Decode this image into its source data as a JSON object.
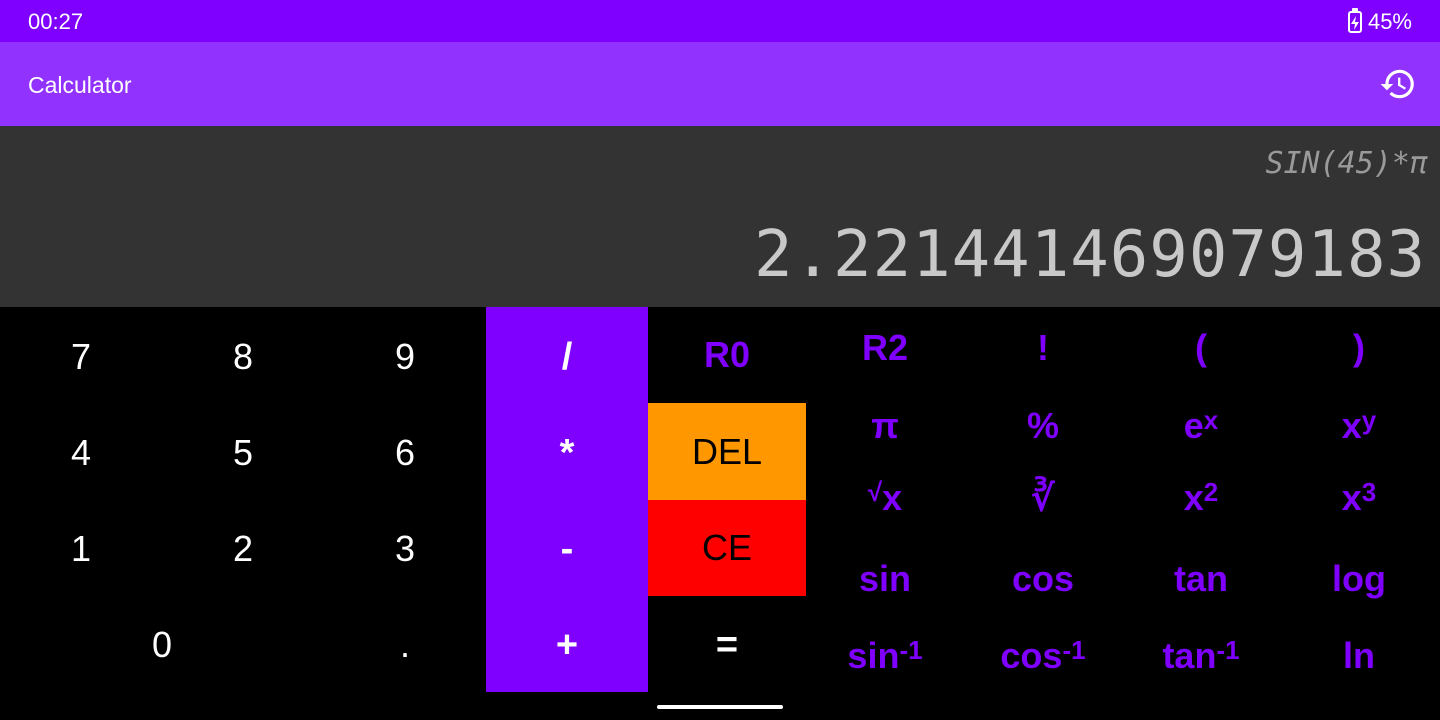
{
  "status_bar": {
    "time": "00:27",
    "battery": "45%"
  },
  "app_bar": {
    "title": "Calculator",
    "history_icon": "history-icon"
  },
  "display": {
    "expression": "SIN(45)*π",
    "result": "2.221441469079183"
  },
  "keypad": {
    "digits": {
      "d7": "7",
      "d8": "8",
      "d9": "9",
      "d4": "4",
      "d5": "5",
      "d6": "6",
      "d1": "1",
      "d2": "2",
      "d3": "3",
      "d0": "0",
      "dot": "."
    },
    "operators": {
      "divide": "/",
      "multiply": "*",
      "minus": "-",
      "plus": "+"
    },
    "controls": {
      "r0": "R0",
      "del": "DEL",
      "ce": "CE",
      "equals": "="
    },
    "scientific": {
      "r2": "R2",
      "fact": "!",
      "lparen": "(",
      "rparen": ")",
      "pi": "π",
      "percent": "%",
      "exp_base": "e",
      "exp_sup": "x",
      "pow_base": "x",
      "pow_sup": "y",
      "sqrt_rad": "√",
      "sqrt_x": "x",
      "cbrt": "∛",
      "sq_base": "x",
      "sq_sup": "2",
      "cube_base": "x",
      "cube_sup": "3",
      "sin": "sin",
      "cos": "cos",
      "tan": "tan",
      "log": "log",
      "asin": "sin",
      "acos": "cos",
      "atan": "tan",
      "inv_sup": "-1",
      "ln": "ln"
    }
  },
  "colors": {
    "status_bar": "#7f00ff",
    "app_bar": "#9132ff",
    "display": "#333333",
    "accent": "#7f00ff",
    "del": "#ff9800",
    "ce": "#ff0000"
  }
}
